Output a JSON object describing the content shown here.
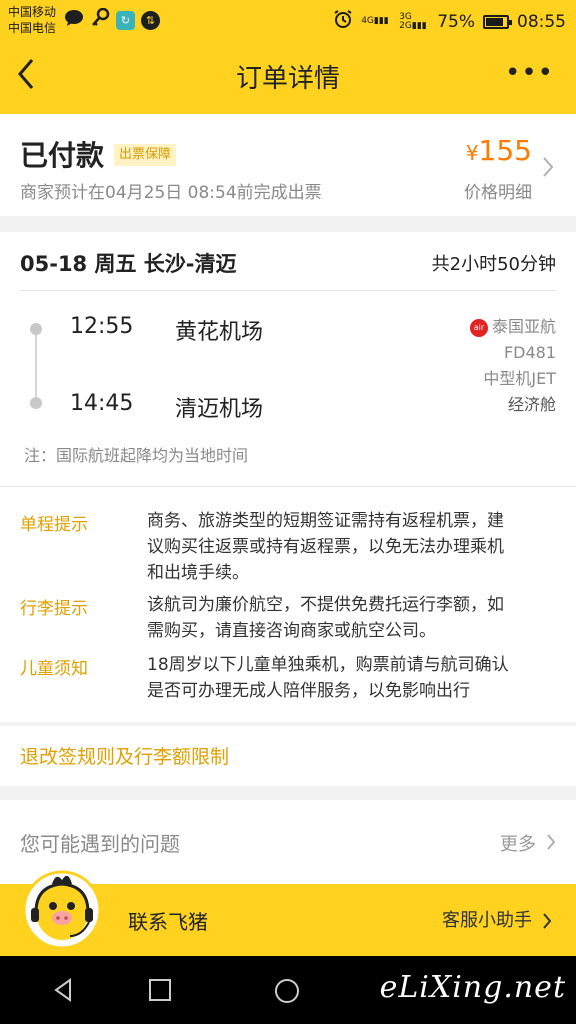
{
  "statusbar": {
    "carrier1": "中国移动",
    "carrier2": "中国电信",
    "net1": "4G",
    "net2": "3G 2G",
    "battery": "75%",
    "time": "08:55"
  },
  "nav": {
    "back": "‹",
    "title": "订单详情",
    "more": "•••"
  },
  "order": {
    "status": "已付款",
    "tag": "出票保障",
    "subtitle": "商家预计在04月25日 08:54前完成出票",
    "currency": "¥",
    "price": "155",
    "price_detail": "价格明细"
  },
  "flight": {
    "route": "05-18 周五 长沙-清迈",
    "duration": "共2小时50分钟",
    "depart_time": "12:55",
    "depart_airport": "黄花机场",
    "arrive_time": "14:45",
    "arrive_airport": "清迈机场",
    "airline": "泰国亚航",
    "flight_no": "FD481",
    "aircraft": "中型机JET",
    "cabin": "经济舱",
    "note": "注：国际航班起降均为当地时间"
  },
  "tips": [
    {
      "label": "单程提示",
      "lines": [
        "商务、旅游类型的短期签证需持有返程机票，建",
        "议购买往返票或持有返程票，以免无法办理乘机",
        "和出境手续。"
      ]
    },
    {
      "label": "行李提示",
      "lines": [
        "该航司为廉价航空，不提供免费托运行李额，如",
        "需购买，请直接咨询商家或航空公司。"
      ]
    },
    {
      "label": "儿童须知",
      "lines": [
        "18周岁以下儿童单独乘机，购票前请与航司确认",
        "是否可办理无成人陪伴服务，以免影响出行"
      ]
    }
  ],
  "rules_link": "退改签规则及行李额限制",
  "faq": {
    "title": "您可能遇到的问题",
    "more": "更多"
  },
  "contact": {
    "label": "联系飞猪",
    "assistant": "客服小助手"
  },
  "watermark": "eLiXing.net",
  "colors": {
    "brand_yellow": "#ffd21f",
    "price_orange": "#ff7a00",
    "tip_label": "#e0a000"
  }
}
